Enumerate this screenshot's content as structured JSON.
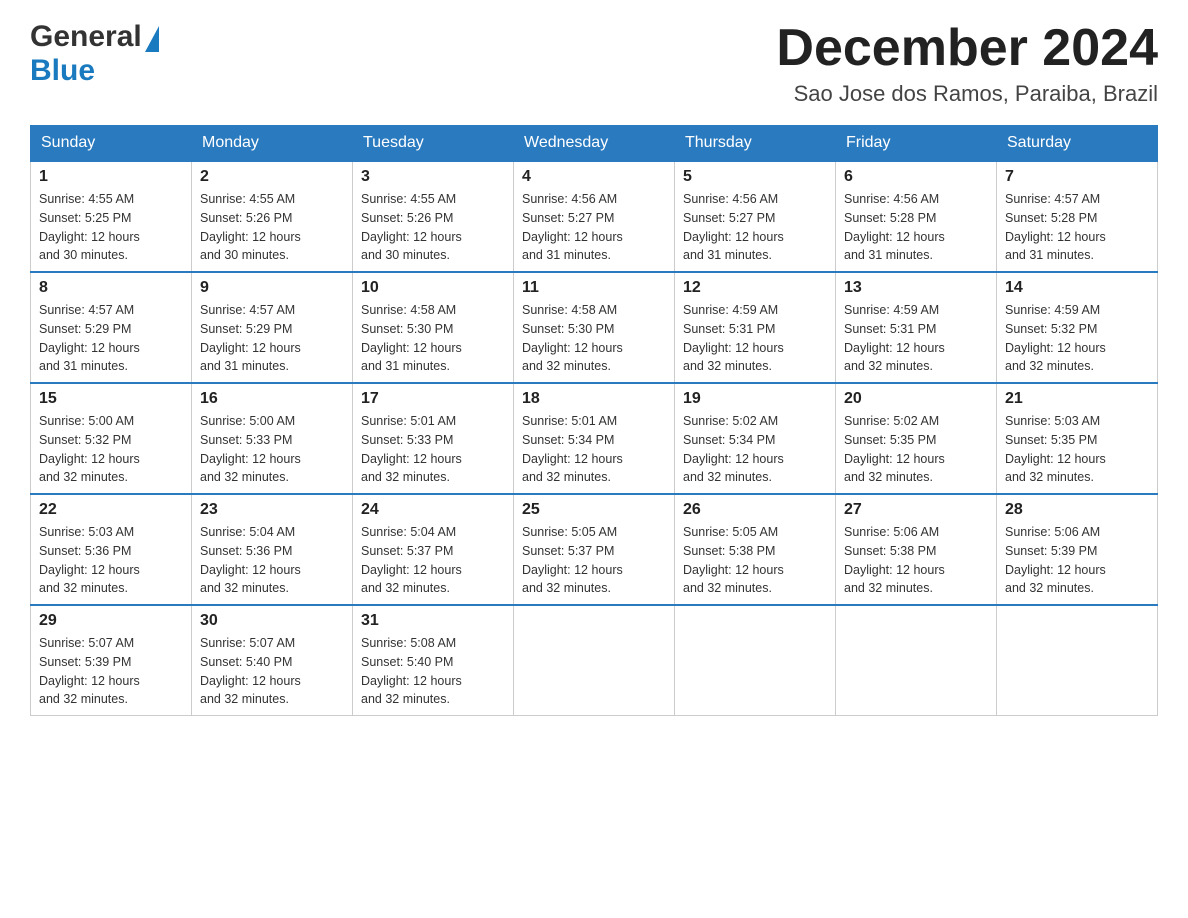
{
  "header": {
    "logo_general": "General",
    "logo_blue": "Blue",
    "month_title": "December 2024",
    "location": "Sao Jose dos Ramos, Paraiba, Brazil"
  },
  "days_of_week": [
    "Sunday",
    "Monday",
    "Tuesday",
    "Wednesday",
    "Thursday",
    "Friday",
    "Saturday"
  ],
  "weeks": [
    [
      {
        "day": "1",
        "sunrise": "4:55 AM",
        "sunset": "5:25 PM",
        "daylight": "12 hours and 30 minutes."
      },
      {
        "day": "2",
        "sunrise": "4:55 AM",
        "sunset": "5:26 PM",
        "daylight": "12 hours and 30 minutes."
      },
      {
        "day": "3",
        "sunrise": "4:55 AM",
        "sunset": "5:26 PM",
        "daylight": "12 hours and 30 minutes."
      },
      {
        "day": "4",
        "sunrise": "4:56 AM",
        "sunset": "5:27 PM",
        "daylight": "12 hours and 31 minutes."
      },
      {
        "day": "5",
        "sunrise": "4:56 AM",
        "sunset": "5:27 PM",
        "daylight": "12 hours and 31 minutes."
      },
      {
        "day": "6",
        "sunrise": "4:56 AM",
        "sunset": "5:28 PM",
        "daylight": "12 hours and 31 minutes."
      },
      {
        "day": "7",
        "sunrise": "4:57 AM",
        "sunset": "5:28 PM",
        "daylight": "12 hours and 31 minutes."
      }
    ],
    [
      {
        "day": "8",
        "sunrise": "4:57 AM",
        "sunset": "5:29 PM",
        "daylight": "12 hours and 31 minutes."
      },
      {
        "day": "9",
        "sunrise": "4:57 AM",
        "sunset": "5:29 PM",
        "daylight": "12 hours and 31 minutes."
      },
      {
        "day": "10",
        "sunrise": "4:58 AM",
        "sunset": "5:30 PM",
        "daylight": "12 hours and 31 minutes."
      },
      {
        "day": "11",
        "sunrise": "4:58 AM",
        "sunset": "5:30 PM",
        "daylight": "12 hours and 32 minutes."
      },
      {
        "day": "12",
        "sunrise": "4:59 AM",
        "sunset": "5:31 PM",
        "daylight": "12 hours and 32 minutes."
      },
      {
        "day": "13",
        "sunrise": "4:59 AM",
        "sunset": "5:31 PM",
        "daylight": "12 hours and 32 minutes."
      },
      {
        "day": "14",
        "sunrise": "4:59 AM",
        "sunset": "5:32 PM",
        "daylight": "12 hours and 32 minutes."
      }
    ],
    [
      {
        "day": "15",
        "sunrise": "5:00 AM",
        "sunset": "5:32 PM",
        "daylight": "12 hours and 32 minutes."
      },
      {
        "day": "16",
        "sunrise": "5:00 AM",
        "sunset": "5:33 PM",
        "daylight": "12 hours and 32 minutes."
      },
      {
        "day": "17",
        "sunrise": "5:01 AM",
        "sunset": "5:33 PM",
        "daylight": "12 hours and 32 minutes."
      },
      {
        "day": "18",
        "sunrise": "5:01 AM",
        "sunset": "5:34 PM",
        "daylight": "12 hours and 32 minutes."
      },
      {
        "day": "19",
        "sunrise": "5:02 AM",
        "sunset": "5:34 PM",
        "daylight": "12 hours and 32 minutes."
      },
      {
        "day": "20",
        "sunrise": "5:02 AM",
        "sunset": "5:35 PM",
        "daylight": "12 hours and 32 minutes."
      },
      {
        "day": "21",
        "sunrise": "5:03 AM",
        "sunset": "5:35 PM",
        "daylight": "12 hours and 32 minutes."
      }
    ],
    [
      {
        "day": "22",
        "sunrise": "5:03 AM",
        "sunset": "5:36 PM",
        "daylight": "12 hours and 32 minutes."
      },
      {
        "day": "23",
        "sunrise": "5:04 AM",
        "sunset": "5:36 PM",
        "daylight": "12 hours and 32 minutes."
      },
      {
        "day": "24",
        "sunrise": "5:04 AM",
        "sunset": "5:37 PM",
        "daylight": "12 hours and 32 minutes."
      },
      {
        "day": "25",
        "sunrise": "5:05 AM",
        "sunset": "5:37 PM",
        "daylight": "12 hours and 32 minutes."
      },
      {
        "day": "26",
        "sunrise": "5:05 AM",
        "sunset": "5:38 PM",
        "daylight": "12 hours and 32 minutes."
      },
      {
        "day": "27",
        "sunrise": "5:06 AM",
        "sunset": "5:38 PM",
        "daylight": "12 hours and 32 minutes."
      },
      {
        "day": "28",
        "sunrise": "5:06 AM",
        "sunset": "5:39 PM",
        "daylight": "12 hours and 32 minutes."
      }
    ],
    [
      {
        "day": "29",
        "sunrise": "5:07 AM",
        "sunset": "5:39 PM",
        "daylight": "12 hours and 32 minutes."
      },
      {
        "day": "30",
        "sunrise": "5:07 AM",
        "sunset": "5:40 PM",
        "daylight": "12 hours and 32 minutes."
      },
      {
        "day": "31",
        "sunrise": "5:08 AM",
        "sunset": "5:40 PM",
        "daylight": "12 hours and 32 minutes."
      },
      null,
      null,
      null,
      null
    ]
  ],
  "labels": {
    "sunrise": "Sunrise:",
    "sunset": "Sunset:",
    "daylight": "Daylight:"
  }
}
